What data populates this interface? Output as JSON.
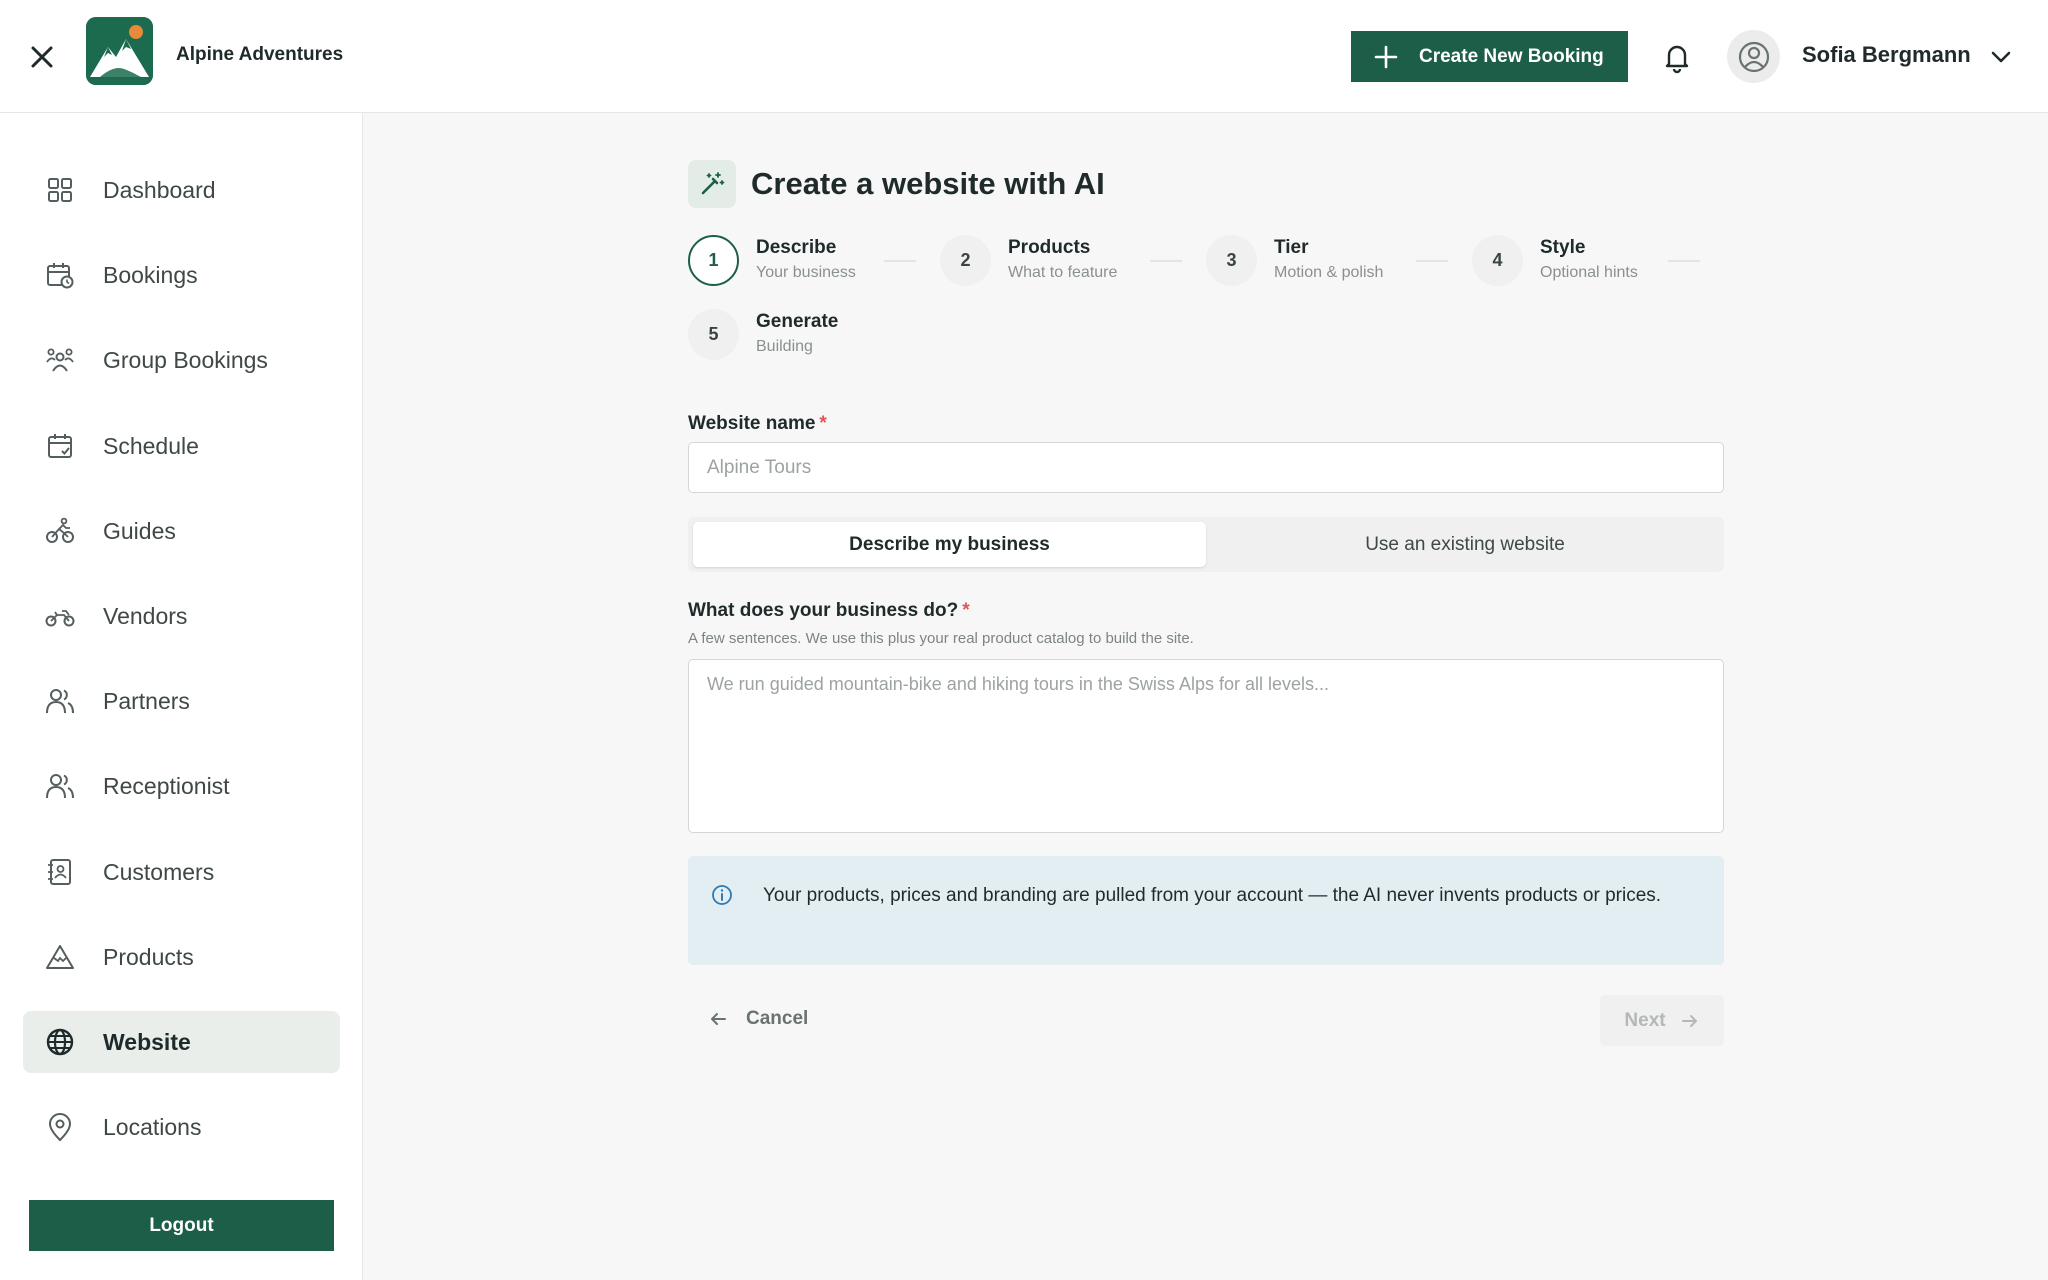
{
  "header": {
    "brand_name": "Alpine Adventures",
    "create_booking_label": "Create New Booking",
    "user_name": "Sofia Bergmann"
  },
  "sidebar": {
    "items": [
      {
        "label": "Dashboard",
        "icon": "grid-icon"
      },
      {
        "label": "Bookings",
        "icon": "calendar-clock-icon"
      },
      {
        "label": "Group Bookings",
        "icon": "group-icon"
      },
      {
        "label": "Schedule",
        "icon": "calendar-check-icon"
      },
      {
        "label": "Guides",
        "icon": "bike-person-icon"
      },
      {
        "label": "Vendors",
        "icon": "motorbike-icon"
      },
      {
        "label": "Partners",
        "icon": "users-icon"
      },
      {
        "label": "Receptionist",
        "icon": "users-icon"
      },
      {
        "label": "Customers",
        "icon": "contact-card-icon"
      },
      {
        "label": "Products",
        "icon": "mountain-icon"
      },
      {
        "label": "Website",
        "icon": "globe-icon",
        "active": true
      },
      {
        "label": "Locations",
        "icon": "map-pin-icon"
      }
    ],
    "logout_label": "Logout"
  },
  "main": {
    "title": "Create a website with AI",
    "steps": [
      {
        "number": "1",
        "title": "Describe",
        "subtitle": "Your business"
      },
      {
        "number": "2",
        "title": "Products",
        "subtitle": "What to feature"
      },
      {
        "number": "3",
        "title": "Tier",
        "subtitle": "Motion & polish"
      },
      {
        "number": "4",
        "title": "Style",
        "subtitle": "Optional hints"
      },
      {
        "number": "5",
        "title": "Generate",
        "subtitle": "Building"
      }
    ],
    "website_name": {
      "label": "Website name",
      "required_mark": "*",
      "value": "",
      "placeholder": "Alpine Tours"
    },
    "mode_toggle": {
      "options": [
        "Describe my business",
        "Use an existing website"
      ],
      "selected": "Describe my business"
    },
    "business": {
      "label": "What does your business do?",
      "required_mark": "*",
      "help": "A few sentences. We use this plus your real product catalog to build the site.",
      "value": "",
      "placeholder": "We run guided mountain-bike and hiking tours in the Swiss Alps for all levels..."
    },
    "info_text": "Your products, prices and branding are pulled from your account — the AI never invents products or prices.",
    "cancel_label": "Cancel",
    "next_label": "Next"
  },
  "colors": {
    "brand_green": "#1c5e47",
    "active_nav_bg": "#e9eeeb",
    "info_bg": "#e3eef3",
    "required": "#e05555"
  }
}
